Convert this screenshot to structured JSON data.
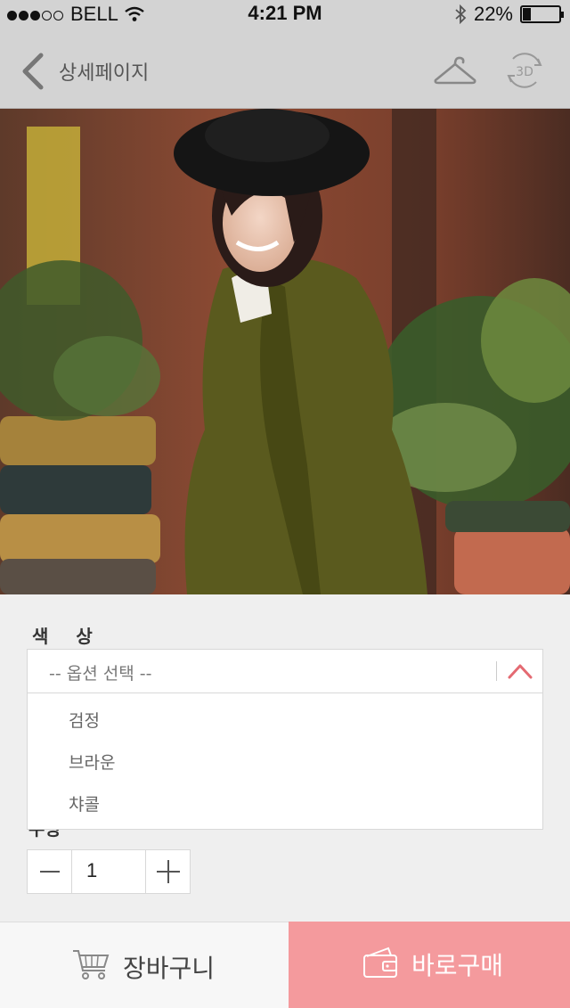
{
  "status_bar": {
    "carrier": "BELL",
    "time": "4:21 PM",
    "battery": "22%",
    "battery_level": 0.22,
    "signal_bars": 3
  },
  "nav": {
    "title": "상세페이지",
    "back_icon": "chevron-left-icon",
    "hanger_icon": "hanger-icon",
    "view3d_icon": "3d-rotate-icon",
    "view3d_label": "3D"
  },
  "options": {
    "color_label": "색 상",
    "placeholder": "-- 옵션 선택 --",
    "items": [
      "검정",
      "브라운",
      "챠콜"
    ],
    "accent": "#e46a72"
  },
  "quantity": {
    "label": "수량",
    "value": "1"
  },
  "bottom": {
    "cart_label": "장바구니",
    "buy_label": "바로구매",
    "buy_color": "#f49a9d"
  }
}
